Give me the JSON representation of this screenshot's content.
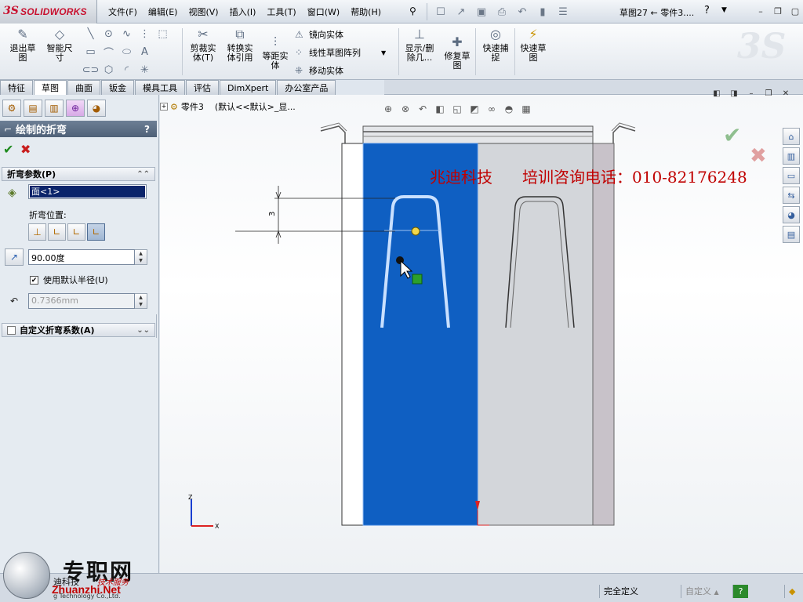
{
  "app": {
    "logo_ds": "3S",
    "logo_name": "SOLIDWORKS",
    "document_title": "草图27 ← 零件3...."
  },
  "menu": [
    "文件(F)",
    "编辑(E)",
    "视图(V)",
    "插入(I)",
    "工具(T)",
    "窗口(W)",
    "帮助(H)"
  ],
  "quick_access": [
    "new-icon",
    "open-icon",
    "save-icon",
    "print-icon",
    "undo-icon",
    "select-icon",
    "options-icon"
  ],
  "command_manager": {
    "exit_sketch": "退出草\n图",
    "smart_dim": "智能尺\n寸",
    "trim": "剪裁实\n体(T)",
    "convert": "转换实\n体引用",
    "offset": "等距实\n体",
    "mirror": "镜向实体",
    "linear_pattern": "线性草图阵列",
    "move": "移动实体",
    "show_delete": "显示/删\n除几...",
    "repair": "修复草\n图",
    "quick_snaps": "快速捕\n捉",
    "rapid_sketch": "快速草\n图"
  },
  "tabs": [
    "特征",
    "草图",
    "曲面",
    "钣金",
    "模具工具",
    "评估",
    "DimXpert",
    "办公室产品"
  ],
  "active_tab": "草图",
  "property_manager": {
    "title": "绘制的折弯",
    "help": "?",
    "group_params": "折弯参数(P)",
    "selected_face": "面<1>",
    "bend_position_label": "折弯位置:",
    "bend_angle": "90.00度",
    "use_default_radius_label": "使用默认半径(U)",
    "use_default_radius_checked": true,
    "radius": "0.7366mm",
    "group_custom": "自定义折弯系数(A)"
  },
  "graphics": {
    "tree_part": "零件3",
    "tree_config": "(默认<<默认>_显...",
    "watermark_company": "兆迪科技",
    "watermark_hotline": "培训咨询电话：010-82176248",
    "dimension_value": "3",
    "axis_z": "Z",
    "axis_x": "X"
  },
  "status": {
    "fully_defined": "完全定义",
    "custom": "自定义",
    "help": "?"
  },
  "brand_overlay": {
    "cn_name": "专职网",
    "site": "Zhuanzhi.Net",
    "company": "迪科技",
    "sub": "技术服务",
    "company_en": "g Technology Co.,Ltd."
  },
  "colors": {
    "sketch_face": "#0f5fc2",
    "part_body": "#d3d6da",
    "watermark": "#c00000",
    "accent_red": "#c8102e"
  }
}
